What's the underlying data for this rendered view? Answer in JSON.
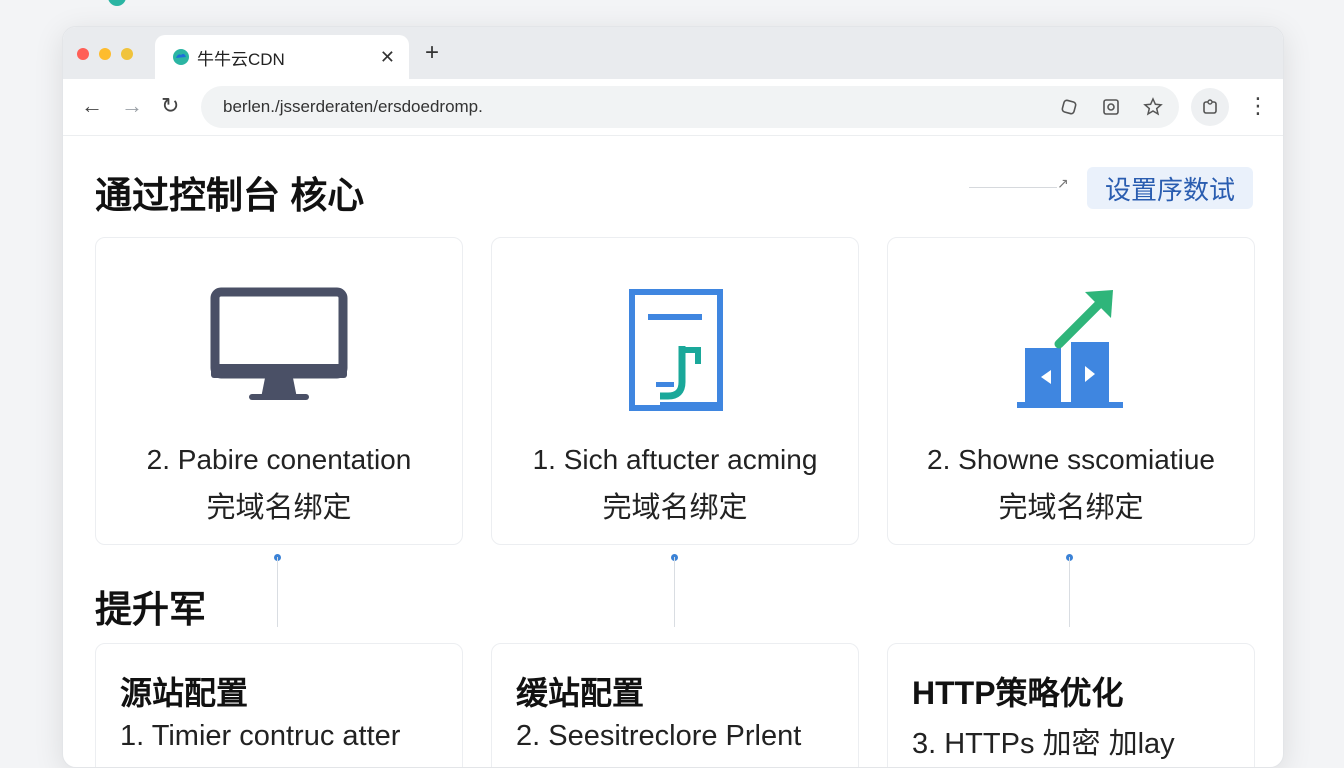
{
  "window": {
    "tab_title": "牛牛云CDN",
    "url": "berlen./jsserderaten/ersdoedromp.",
    "colors": {
      "accent": "#2a5db0",
      "accent_bg": "#eaf1fb",
      "logo": "#2bb5a3"
    }
  },
  "header": {
    "title": "通过控制台 核心",
    "setting_button": "设置序数试"
  },
  "cards": [
    {
      "icon": "monitor-icon",
      "step": "2. Pabire conentation",
      "sub": "完域名绑定"
    },
    {
      "icon": "document-icon",
      "step": "1. Sich aftucter acming",
      "sub": "完域名绑定"
    },
    {
      "icon": "growth-chart-icon",
      "step": "2. Showne sscomiatiue",
      "sub": "完域名绑定"
    }
  ],
  "section": {
    "title": "提升军"
  },
  "bottom_cards": [
    {
      "title": "源站配置",
      "desc": "1. Timier contruc atter"
    },
    {
      "title": "缓站配置",
      "desc": "2. Seesitreclore Prlent"
    },
    {
      "title": "HTTP策略优化",
      "desc": "3. HTTPs 加密 加lay"
    }
  ]
}
